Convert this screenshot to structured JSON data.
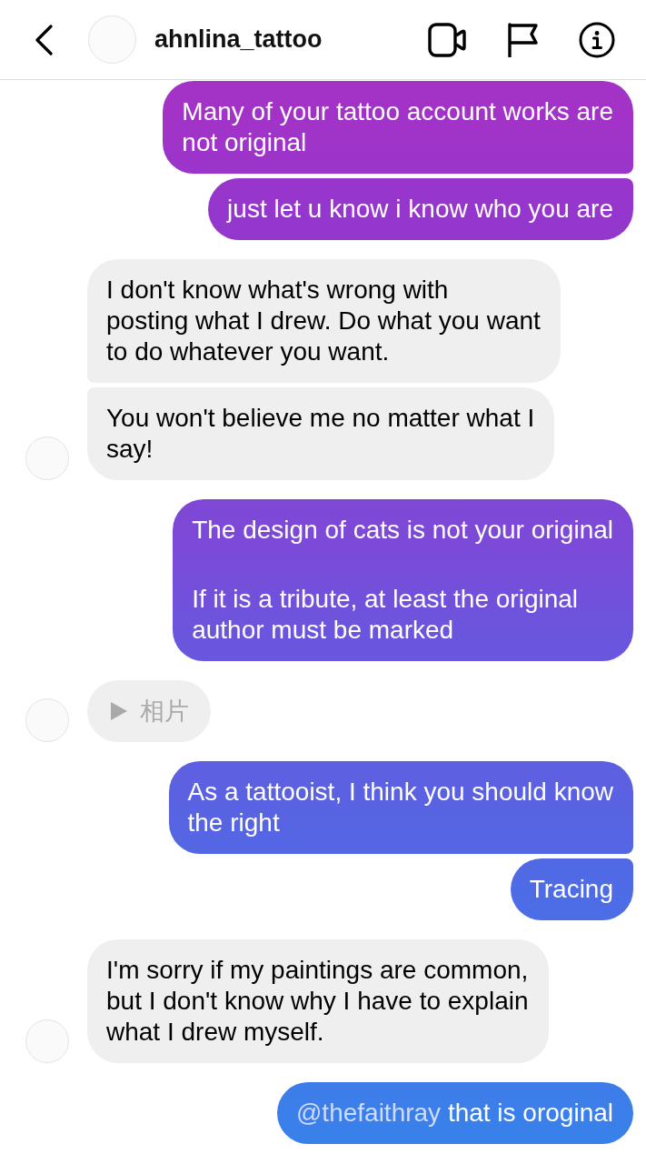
{
  "header": {
    "username": "ahnlina_tattoo"
  },
  "messages": [
    {
      "kind": "text",
      "outgoing": true,
      "paragraphs": [
        [
          "Many of your tattoo account works are",
          "not original"
        ]
      ]
    },
    {
      "kind": "text",
      "outgoing": true,
      "paragraphs": [
        [
          "just let u know i know who you are"
        ]
      ]
    },
    {
      "kind": "text",
      "outgoing": false,
      "paragraphs": [
        [
          "I don't know what's wrong with",
          "posting what I drew. Do what you want",
          "to do whatever you want."
        ]
      ]
    },
    {
      "kind": "text",
      "outgoing": false,
      "paragraphs": [
        [
          "You won't believe me no matter what I",
          "say!"
        ]
      ]
    },
    {
      "kind": "text",
      "outgoing": true,
      "paragraphs": [
        [
          "The design of cats is not your original"
        ],
        [
          "If it is a tribute, at least the original",
          "author must be marked"
        ]
      ]
    },
    {
      "kind": "photo",
      "outgoing": false,
      "label": "相片"
    },
    {
      "kind": "text",
      "outgoing": true,
      "paragraphs": [
        [
          "As a tattooist, I think you should know",
          "the right"
        ]
      ]
    },
    {
      "kind": "text",
      "outgoing": true,
      "paragraphs": [
        [
          "Tracing"
        ]
      ]
    },
    {
      "kind": "text",
      "outgoing": false,
      "paragraphs": [
        [
          "I'm sorry if my paintings are common,",
          "but I don't know why I have to explain",
          "what I drew myself."
        ]
      ]
    },
    {
      "kind": "text",
      "outgoing": true,
      "mention": "@thefaithray",
      "paragraphs": [
        [
          "that is oroginal"
        ]
      ]
    }
  ]
}
